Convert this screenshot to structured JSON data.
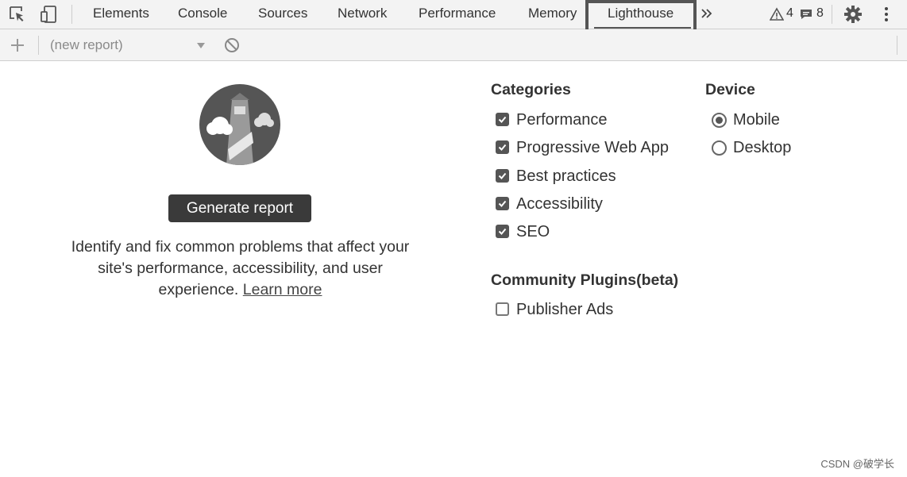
{
  "toolbar": {
    "tabs": [
      "Elements",
      "Console",
      "Sources",
      "Network",
      "Performance",
      "Memory",
      "Lighthouse"
    ],
    "active_tab": "Lighthouse",
    "overflow_icon": "double-chevron-right-icon",
    "warnings_count": "4",
    "messages_count": "8"
  },
  "subbar": {
    "report_select_value": "(new report)"
  },
  "main": {
    "generate_label": "Generate report",
    "description": "Identify and fix common problems that affect your site's performance, accessibility, and user experience.",
    "learn_more": "Learn more"
  },
  "categories": {
    "title": "Categories",
    "items": [
      {
        "label": "Performance",
        "checked": true
      },
      {
        "label": "Progressive Web App",
        "checked": true
      },
      {
        "label": "Best practices",
        "checked": true
      },
      {
        "label": "Accessibility",
        "checked": true
      },
      {
        "label": "SEO",
        "checked": true
      }
    ]
  },
  "device": {
    "title": "Device",
    "options": [
      {
        "label": "Mobile",
        "selected": true
      },
      {
        "label": "Desktop",
        "selected": false
      }
    ]
  },
  "plugins": {
    "title": "Community Plugins(beta)",
    "items": [
      {
        "label": "Publisher Ads",
        "checked": false
      }
    ]
  },
  "watermark": "CSDN @破学长"
}
